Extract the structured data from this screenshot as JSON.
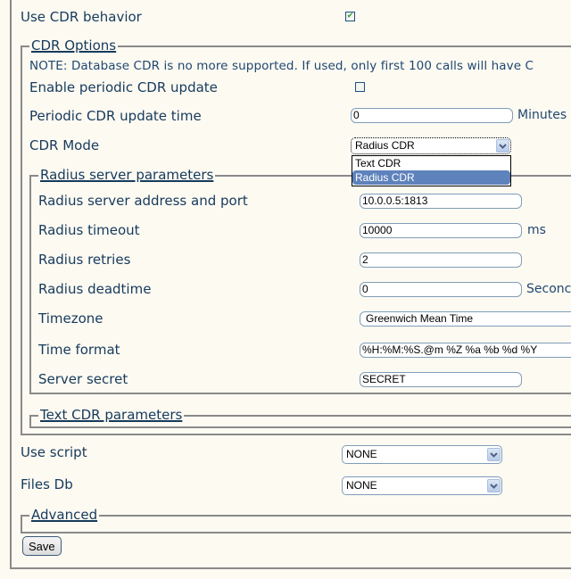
{
  "use_cdr": {
    "label": "Use CDR behavior",
    "checked": true
  },
  "cdr_options": {
    "legend": "CDR Options",
    "note": "NOTE: Database CDR is no more supported. If used, only first 100 calls will have C",
    "enable_periodic": {
      "label": "Enable periodic CDR update",
      "checked": false
    },
    "periodic_time": {
      "label": "Periodic CDR update time",
      "value": "0",
      "unit": "Minutes"
    },
    "cdr_mode": {
      "label": "CDR Mode",
      "selected": "Radius CDR",
      "options": [
        "Text CDR",
        "Radius CDR"
      ]
    },
    "radius": {
      "legend": "Radius server parameters",
      "address": {
        "label": "Radius server address and port",
        "value": "10.0.0.5:1813"
      },
      "timeout": {
        "label": "Radius timeout",
        "value": "10000",
        "unit": "ms"
      },
      "retries": {
        "label": "Radius retries",
        "value": "2"
      },
      "deadtime": {
        "label": "Radius deadtime",
        "value": "0",
        "unit": "Seconc"
      },
      "timezone": {
        "label": "Timezone",
        "value": "Greenwich Mean Time"
      },
      "time_format": {
        "label": "Time format",
        "value": "%H:%M:%S.@m %Z %a %b %d %Y"
      },
      "server_secret": {
        "label": "Server secret",
        "value": "SECRET"
      }
    },
    "text_cdr": {
      "legend": "Text CDR parameters"
    }
  },
  "use_script": {
    "label": "Use script",
    "selected": "NONE"
  },
  "files_db": {
    "label": "Files Db",
    "selected": "NONE"
  },
  "advanced": {
    "legend": "Advanced"
  },
  "save": {
    "label": "Save"
  },
  "icons": {
    "checkmark": "✔",
    "chevron": "chevron-down"
  },
  "colors": {
    "background": "#fdfaf2",
    "text": "#163a5c",
    "border": "#8a8a8a",
    "selection": "#5e82bc",
    "check": "#2a9a2a"
  }
}
